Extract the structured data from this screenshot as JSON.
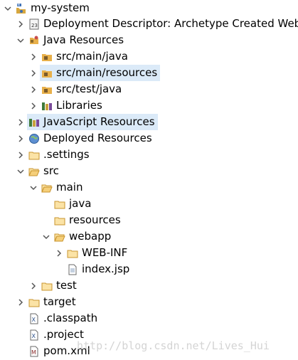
{
  "explorer": {
    "items": [
      {
        "label": "my-system",
        "icon": "web-project-icon",
        "expanded": true
      },
      {
        "label": "Deployment Descriptor: Archetype Created Web",
        "icon": "deployment-descriptor-icon",
        "expanded": false
      },
      {
        "label": "Java Resources",
        "icon": "java-resources-icon",
        "expanded": true
      },
      {
        "label": "src/main/java",
        "icon": "source-folder-icon",
        "expanded": false
      },
      {
        "label": "src/main/resources",
        "icon": "source-folder-icon",
        "expanded": false,
        "selected": true
      },
      {
        "label": "src/test/java",
        "icon": "source-folder-icon",
        "expanded": false
      },
      {
        "label": "Libraries",
        "icon": "libraries-icon",
        "expanded": false
      },
      {
        "label": "JavaScript Resources",
        "icon": "libraries-icon",
        "expanded": false,
        "selected": true
      },
      {
        "label": "Deployed Resources",
        "icon": "globe-icon",
        "expanded": false
      },
      {
        "label": ".settings",
        "icon": "folder-icon",
        "expanded": false
      },
      {
        "label": "src",
        "icon": "folder-icon",
        "expanded": true
      },
      {
        "label": "main",
        "icon": "folder-icon",
        "expanded": true
      },
      {
        "label": "java",
        "icon": "folder-icon"
      },
      {
        "label": "resources",
        "icon": "folder-icon"
      },
      {
        "label": "webapp",
        "icon": "folder-icon",
        "expanded": true
      },
      {
        "label": "WEB-INF",
        "icon": "folder-icon",
        "expanded": false
      },
      {
        "label": "index.jsp",
        "icon": "jsp-file-icon"
      },
      {
        "label": "test",
        "icon": "folder-icon",
        "expanded": false
      },
      {
        "label": "target",
        "icon": "folder-icon",
        "expanded": false
      },
      {
        "label": ".classpath",
        "icon": "xml-file-icon"
      },
      {
        "label": ".project",
        "icon": "xml-file-icon"
      },
      {
        "label": "pom.xml",
        "icon": "maven-pom-icon"
      }
    ]
  },
  "watermark": "http://blog.csdn.net/Lives_Hui",
  "colors": {
    "selection": "#dbeaf8",
    "folder": "#e8b04a",
    "arrow": "#555555"
  }
}
